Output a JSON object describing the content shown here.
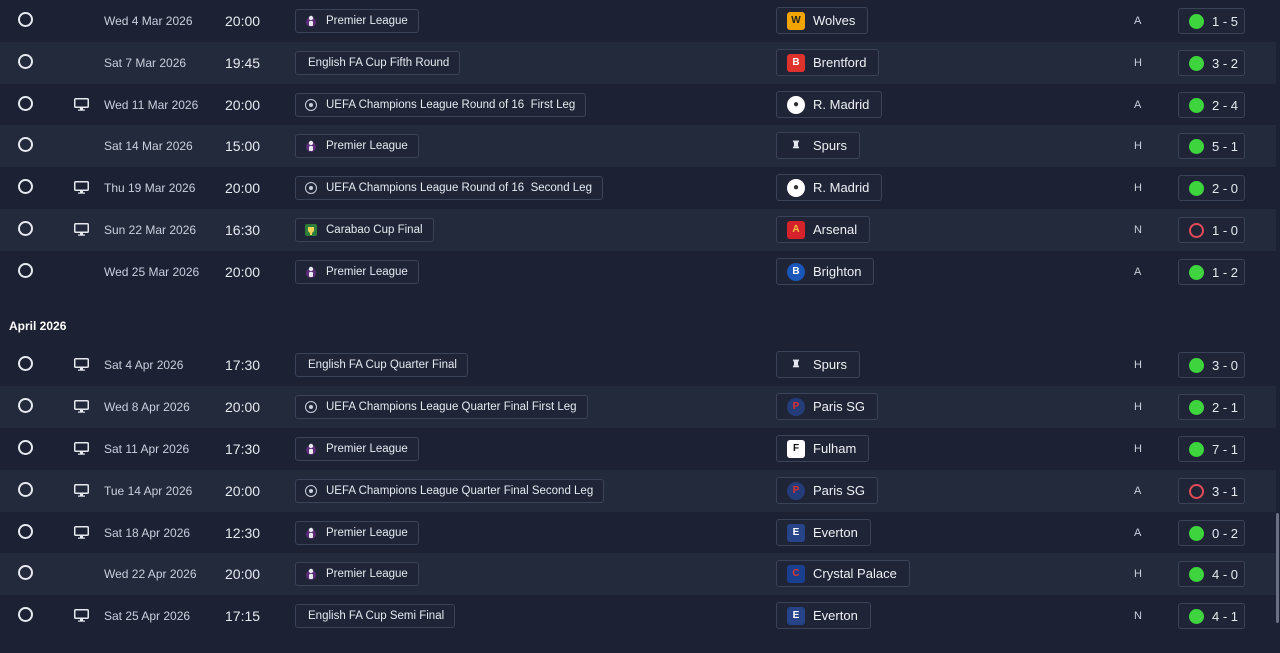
{
  "month_header": "April 2026",
  "colors": {
    "win": "#3ed43e",
    "loss": "#e24a5a",
    "row_odd": "#1c2233",
    "row_even": "#232a3c"
  },
  "fixtures": [
    {
      "date": "Wed 4 Mar 2026",
      "time": "20:00",
      "tv": false,
      "competition": "Premier League",
      "comp_icon": "premier-league-icon",
      "opponent": "Wolves",
      "opp_icon": "wolves-crest-icon",
      "venue": "A",
      "score": "1 - 5",
      "outcome": "win"
    },
    {
      "date": "Sat 7 Mar 2026",
      "time": "19:45",
      "tv": false,
      "competition": "English FA Cup Fifth Round",
      "comp_icon": "",
      "opponent": "Brentford",
      "opp_icon": "brentford-crest-icon",
      "venue": "H",
      "score": "3 - 2",
      "outcome": "win"
    },
    {
      "date": "Wed 11 Mar 2026",
      "time": "20:00",
      "tv": true,
      "competition": "UEFA Champions League Round of 16  First Leg",
      "comp_icon": "champions-league-icon",
      "opponent": "R. Madrid",
      "opp_icon": "real-madrid-crest-icon",
      "venue": "A",
      "score": "2 - 4",
      "outcome": "win"
    },
    {
      "date": "Sat 14 Mar 2026",
      "time": "15:00",
      "tv": false,
      "competition": "Premier League",
      "comp_icon": "premier-league-icon",
      "opponent": "Spurs",
      "opp_icon": "spurs-crest-icon",
      "venue": "H",
      "score": "5 - 1",
      "outcome": "win"
    },
    {
      "date": "Thu 19 Mar 2026",
      "time": "20:00",
      "tv": true,
      "competition": "UEFA Champions League Round of 16  Second Leg",
      "comp_icon": "champions-league-icon",
      "opponent": "R. Madrid",
      "opp_icon": "real-madrid-crest-icon",
      "venue": "H",
      "score": "2 - 0",
      "outcome": "win"
    },
    {
      "date": "Sun 22 Mar 2026",
      "time": "16:30",
      "tv": true,
      "competition": "Carabao Cup Final",
      "comp_icon": "carabao-cup-icon",
      "opponent": "Arsenal",
      "opp_icon": "arsenal-crest-icon",
      "venue": "N",
      "score": "1 - 0",
      "outcome": "loss"
    },
    {
      "date": "Wed 25 Mar 2026",
      "time": "20:00",
      "tv": false,
      "competition": "Premier League",
      "comp_icon": "premier-league-icon",
      "opponent": "Brighton",
      "opp_icon": "brighton-crest-icon",
      "venue": "A",
      "score": "1 - 2",
      "outcome": "win"
    },
    {
      "date": "Sat 4 Apr 2026",
      "time": "17:30",
      "tv": true,
      "competition": "English FA Cup Quarter Final",
      "comp_icon": "",
      "opponent": "Spurs",
      "opp_icon": "spurs-crest-icon",
      "venue": "H",
      "score": "3 - 0",
      "outcome": "win"
    },
    {
      "date": "Wed 8 Apr 2026",
      "time": "20:00",
      "tv": true,
      "competition": "UEFA Champions League Quarter Final First Leg",
      "comp_icon": "champions-league-icon",
      "opponent": "Paris SG",
      "opp_icon": "psg-crest-icon",
      "venue": "H",
      "score": "2 - 1",
      "outcome": "win"
    },
    {
      "date": "Sat 11 Apr 2026",
      "time": "17:30",
      "tv": true,
      "competition": "Premier League",
      "comp_icon": "premier-league-icon",
      "opponent": "Fulham",
      "opp_icon": "fulham-crest-icon",
      "venue": "H",
      "score": "7 - 1",
      "outcome": "win"
    },
    {
      "date": "Tue 14 Apr 2026",
      "time": "20:00",
      "tv": true,
      "competition": "UEFA Champions League Quarter Final Second Leg",
      "comp_icon": "champions-league-icon",
      "opponent": "Paris SG",
      "opp_icon": "psg-crest-icon",
      "venue": "A",
      "score": "3 - 1",
      "outcome": "loss"
    },
    {
      "date": "Sat 18 Apr 2026",
      "time": "12:30",
      "tv": true,
      "competition": "Premier League",
      "comp_icon": "premier-league-icon",
      "opponent": "Everton",
      "opp_icon": "everton-crest-icon",
      "venue": "A",
      "score": "0 - 2",
      "outcome": "win"
    },
    {
      "date": "Wed 22 Apr 2026",
      "time": "20:00",
      "tv": false,
      "competition": "Premier League",
      "comp_icon": "premier-league-icon",
      "opponent": "Crystal Palace",
      "opp_icon": "crystal-palace-crest-icon",
      "venue": "H",
      "score": "4 - 0",
      "outcome": "win"
    },
    {
      "date": "Sat 25 Apr 2026",
      "time": "17:15",
      "tv": true,
      "competition": "English FA Cup Semi Final",
      "comp_icon": "",
      "opponent": "Everton",
      "opp_icon": "everton-crest-icon",
      "venue": "N",
      "score": "4 - 1",
      "outcome": "win"
    }
  ]
}
